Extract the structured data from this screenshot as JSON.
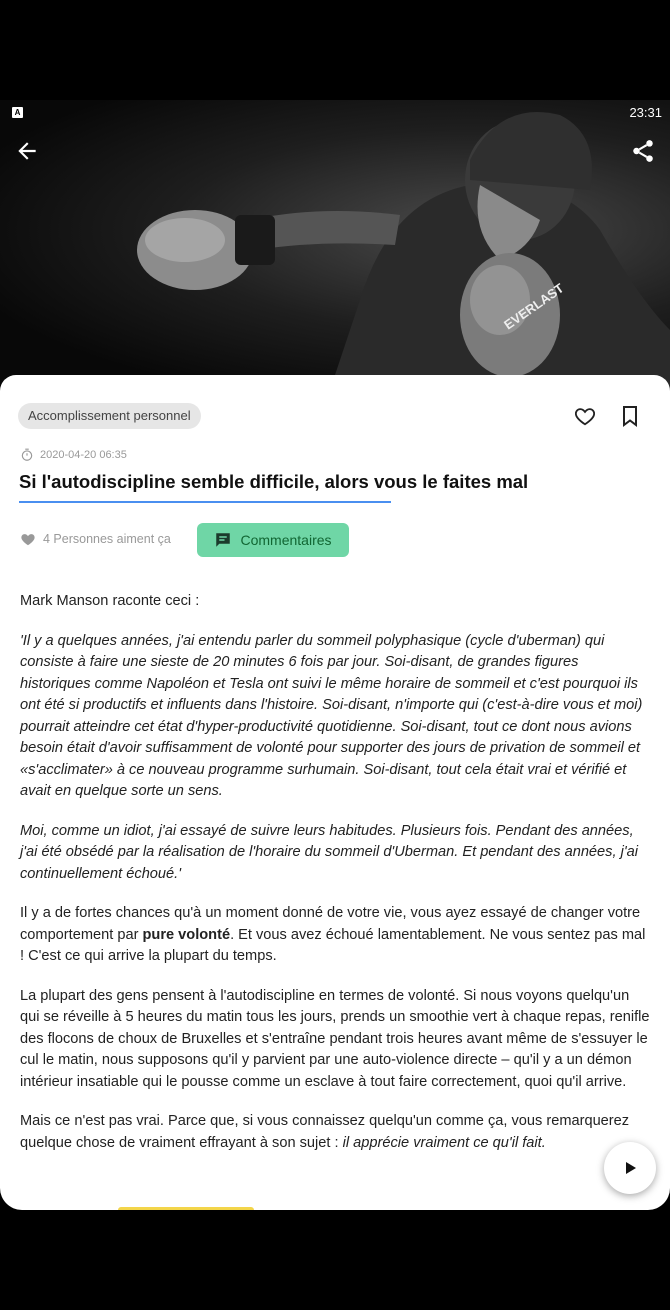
{
  "status_bar": {
    "indicator": "A",
    "time": "23:31"
  },
  "toolbar": {
    "back_icon": "arrow-left-icon",
    "share_icon": "share-icon"
  },
  "article": {
    "category": "Accomplissement personnel",
    "date": "2020-04-20 06:35",
    "title": "Si l'autodiscipline semble difficile, alors vous le faites mal",
    "likes_text": "4 Personnes aiment ça",
    "comments_label": "Commentaires",
    "paragraphs": {
      "p1": "Mark Manson raconte ceci :",
      "p2": "'Il y a quelques années, j'ai entendu parler du sommeil polyphasique (cycle d'uberman) qui consiste à faire une sieste de 20 minutes 6 fois par jour. Soi-disant, de grandes figures historiques comme Napoléon et Tesla ont suivi le même horaire de sommeil et c'est pourquoi ils ont été si productifs et influents dans l'histoire. Soi-disant, n'importe qui (c'est-à-dire vous et moi) pourrait atteindre cet état d'hyper-productivité quotidienne. Soi-disant, tout ce dont nous avions besoin était d'avoir suffisamment de volonté pour supporter des jours de privation de sommeil et «s'acclimater» à ce nouveau programme surhumain. Soi-disant, tout cela était vrai et vérifié et avait en quelque sorte un sens.",
      "p3": "Moi, comme un idiot, j'ai essayé de suivre leurs habitudes. Plusieurs fois. Pendant des années, j'ai été obsédé par la réalisation de l'horaire du sommeil d'Uberman. Et pendant des années, j'ai continuellement échoué.'",
      "p4_before": "Il y a de fortes chances qu'à un moment donné de votre vie, vous ayez essayé de changer votre comportement par ",
      "p4_bold": "pure volonté",
      "p4_after": ". Et vous avez échoué lamentablement. Ne vous sentez pas mal ! C'est ce qui arrive la plupart du temps.",
      "p5": "La plupart des gens pensent à l'autodiscipline en termes de volonté. Si nous voyons quelqu'un qui se réveille à 5 heures du matin tous les jours, prends un smoothie vert à chaque repas, renifle des flocons de choux de Bruxelles et s'entraîne pendant trois heures avant même de s'essuyer le cul le matin, nous supposons qu'il y parvient par une auto-violence directe – qu'il y a un démon intérieur insatiable qui le pousse comme un esclave à tout faire correctement, quoi qu'il arrive.",
      "p6_before": "Mais ce n'est pas vrai. Parce que, si vous connaissez quelqu'un comme ça, vous remarquerez quelque chose de vraiment effrayant à son sujet : ",
      "p6_italic": "il apprécie vraiment ce qu'il fait."
    }
  },
  "hero_image": {
    "glove_brand": "EVERLAST"
  },
  "colors": {
    "accent_underline": "#4a8ff0",
    "comments_button": "#6fd6a6",
    "tag_bg": "#e6e6e6"
  },
  "icons": [
    "arrow-left-icon",
    "share-icon",
    "heart-outline-icon",
    "bookmark-icon",
    "timer-icon",
    "heart-filled-icon",
    "comment-icon",
    "play-icon"
  ]
}
